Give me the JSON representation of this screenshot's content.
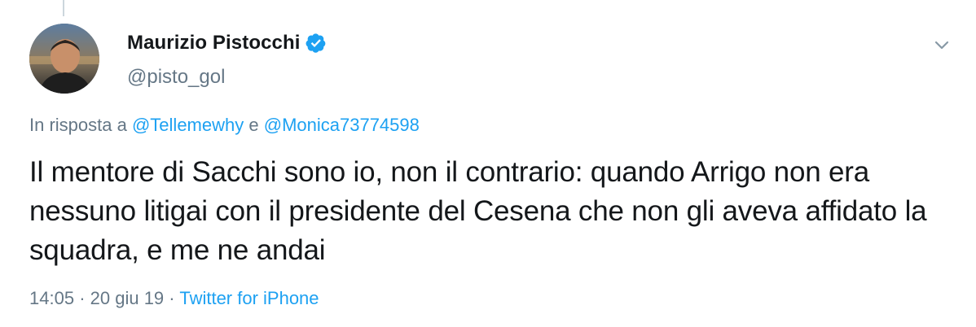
{
  "tweet": {
    "author": {
      "display_name": "Maurizio Pistocchi",
      "handle": "@pisto_gol",
      "verified": true
    },
    "reply": {
      "prefix": "In risposta a",
      "mention_1": "@Tellemewhy",
      "conjunction": "e",
      "mention_2": "@Monica73774598"
    },
    "text": "Il mentore di Sacchi sono io, non il contrario: quando Arrigo non era nessuno litigai con il presidente del Cesena che non gli aveva affidato la squadra, e me ne andai",
    "time": "14:05",
    "separator_1": "·",
    "date": "20 giu 19",
    "separator_2": "·",
    "source": "Twitter for iPhone"
  },
  "icons": {
    "verified": "verified-badge-icon",
    "menu": "chevron-down-icon"
  },
  "colors": {
    "link": "#1da1f2",
    "secondary_text": "#657786",
    "primary_text": "#14171a"
  }
}
